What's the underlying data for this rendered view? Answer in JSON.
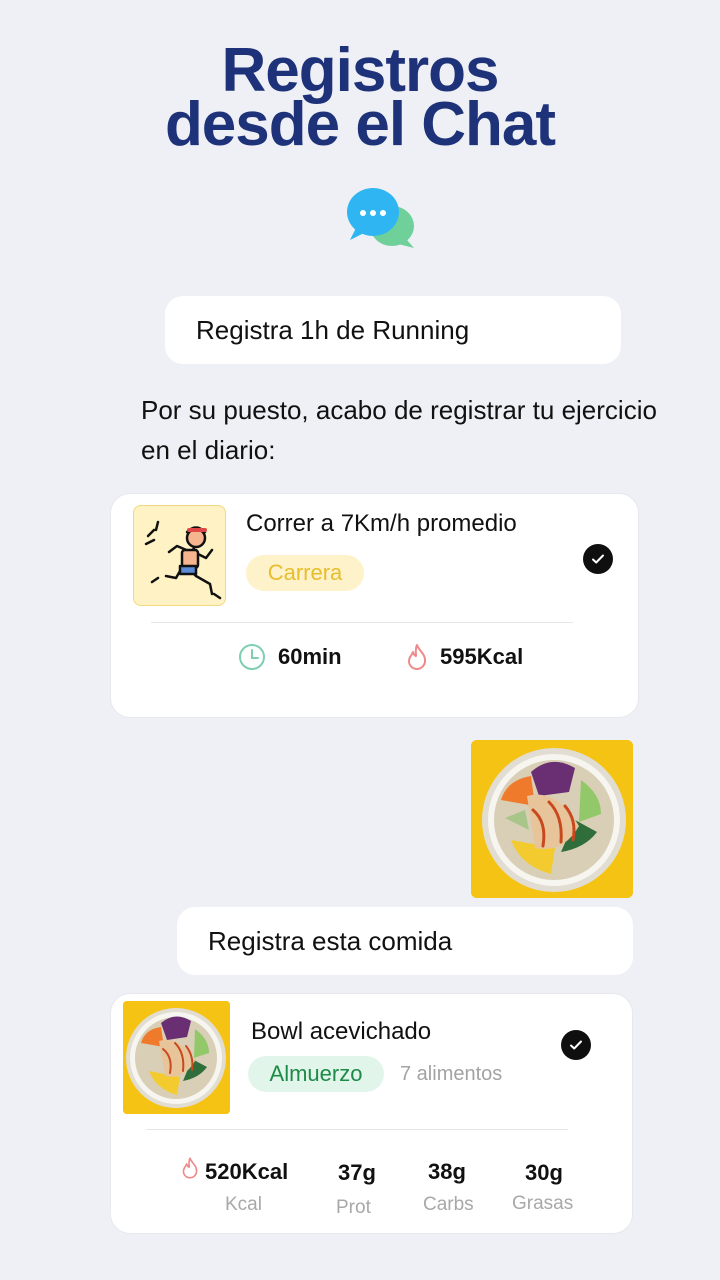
{
  "header": {
    "title_line1": "Registros",
    "title_line2": "desde el Chat",
    "icon": "chat-bubbles-icon"
  },
  "chat": {
    "user_message_1": "Registra 1h de Running",
    "assistant_reply": "Por su puesto, acabo de registrar tu ejercicio en el diario:",
    "user_message_2": "Registra esta comida"
  },
  "exercise_card": {
    "title": "Correr a 7Km/h promedio",
    "tag": "Carrera",
    "duration": "60min",
    "calories": "595Kcal",
    "icons": [
      "runner-icon",
      "clock-icon",
      "flame-icon",
      "check-icon"
    ]
  },
  "meal_card": {
    "title": "Bowl acevichado",
    "tag": "Almuerzo",
    "items_count": "7 alimentos",
    "macros": [
      {
        "value": "520Kcal",
        "label": "Kcal"
      },
      {
        "value": "37g",
        "label": "Prot"
      },
      {
        "value": "38g",
        "label": "Carbs"
      },
      {
        "value": "30g",
        "label": "Grasas"
      }
    ],
    "icons": [
      "bowl-photo",
      "flame-icon",
      "check-icon"
    ]
  },
  "colors": {
    "background": "#eef0f5",
    "title": "#1e3279",
    "tag_carrera_bg": "#fdf2c9",
    "tag_carrera_text": "#e8bd2e",
    "tag_almuerzo_bg": "#e2f5ea",
    "tag_almuerzo_text": "#1d8b47"
  }
}
